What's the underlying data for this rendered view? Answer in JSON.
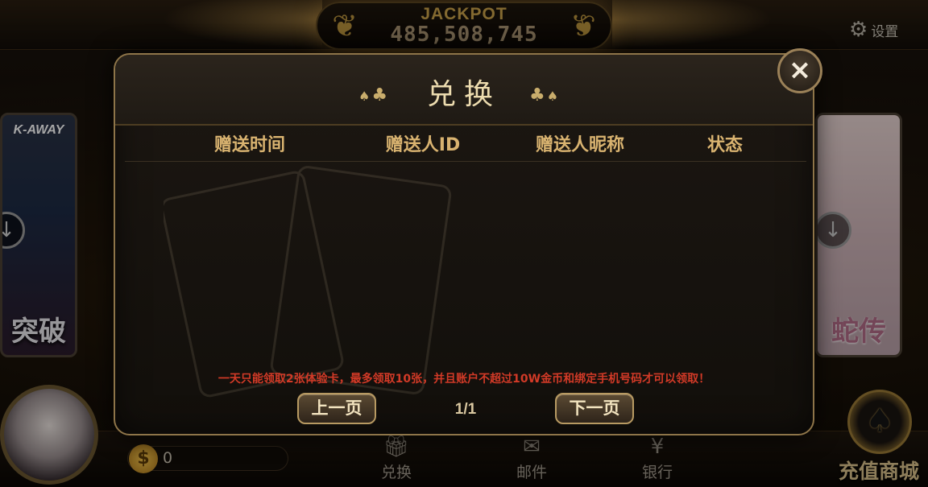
{
  "jackpot": {
    "label": "JACKPOT",
    "value": "485,508,745"
  },
  "settings": {
    "label": "设置",
    "icon": "gear-icon"
  },
  "games": {
    "left": {
      "top_text": "K-AWAY",
      "title": "突破"
    },
    "right": {
      "title": "蛇传"
    }
  },
  "bottom": {
    "coins": "0",
    "coin_symbol": "$",
    "nav": [
      {
        "label": "兑换",
        "icon": "gift-icon"
      },
      {
        "label": "邮件",
        "icon": "mail-icon"
      },
      {
        "label": "银行",
        "icon": "bank-icon"
      }
    ],
    "shop_label": "充值商城"
  },
  "modal": {
    "title": "兑换",
    "columns": [
      "赠送时间",
      "赠送人ID",
      "赠送人昵称",
      "状态"
    ],
    "rows": [],
    "notice": "一天只能领取2张体验卡，最多领取10张，并且账户不超过10W金币和绑定手机号码才可以领取！",
    "prev_label": "上一页",
    "next_label": "下一页",
    "page": "1/1",
    "close_symbol": "×"
  },
  "colors": {
    "accent_gold": "#d9b370",
    "notice_red": "#d23a27",
    "modal_border": "#8e7549"
  }
}
